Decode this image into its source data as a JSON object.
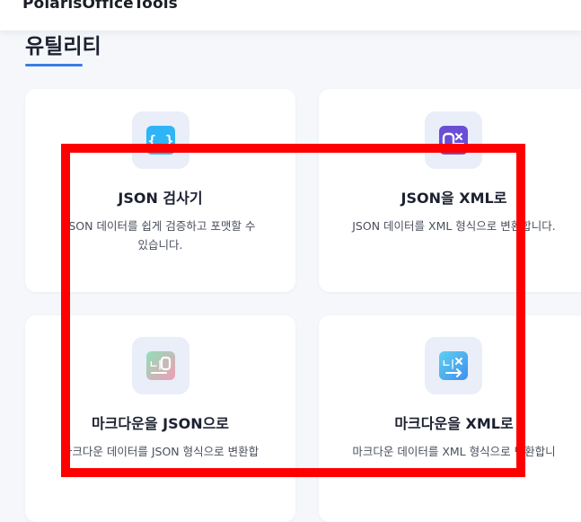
{
  "app": {
    "title": "PolarisOfficeTools"
  },
  "section": {
    "title": "유틸리티"
  },
  "cards": [
    {
      "title": "JSON 검사기",
      "desc_line1": "JSON 데이터를 쉽게 검증하고 포맷할 수",
      "desc_line2": "있습니다.",
      "icon": "json-braces-icon",
      "accent": "#33b6f5"
    },
    {
      "title": "JSON을 XML로",
      "desc_line1": "JSON 데이터를 XML 형식으로 변환합니다.",
      "desc_line2": "",
      "icon": "json-to-xml-icon",
      "accent": "#6b4fd6"
    },
    {
      "title": "마크다운을 JSON으로",
      "desc_line1": "마크다운 데이터를 JSON 형식으로 변환합",
      "desc_line2": "",
      "icon": "markdown-to-json-icon",
      "accent": "#7ed3b6"
    },
    {
      "title": "마크다운을 XML로",
      "desc_line1": "마크다운 데이터를 XML 형식으로 변환합니",
      "desc_line2": "",
      "icon": "markdown-to-xml-icon",
      "accent": "#4fb7ef"
    }
  ],
  "overlay": {
    "color": "#ff0000"
  }
}
